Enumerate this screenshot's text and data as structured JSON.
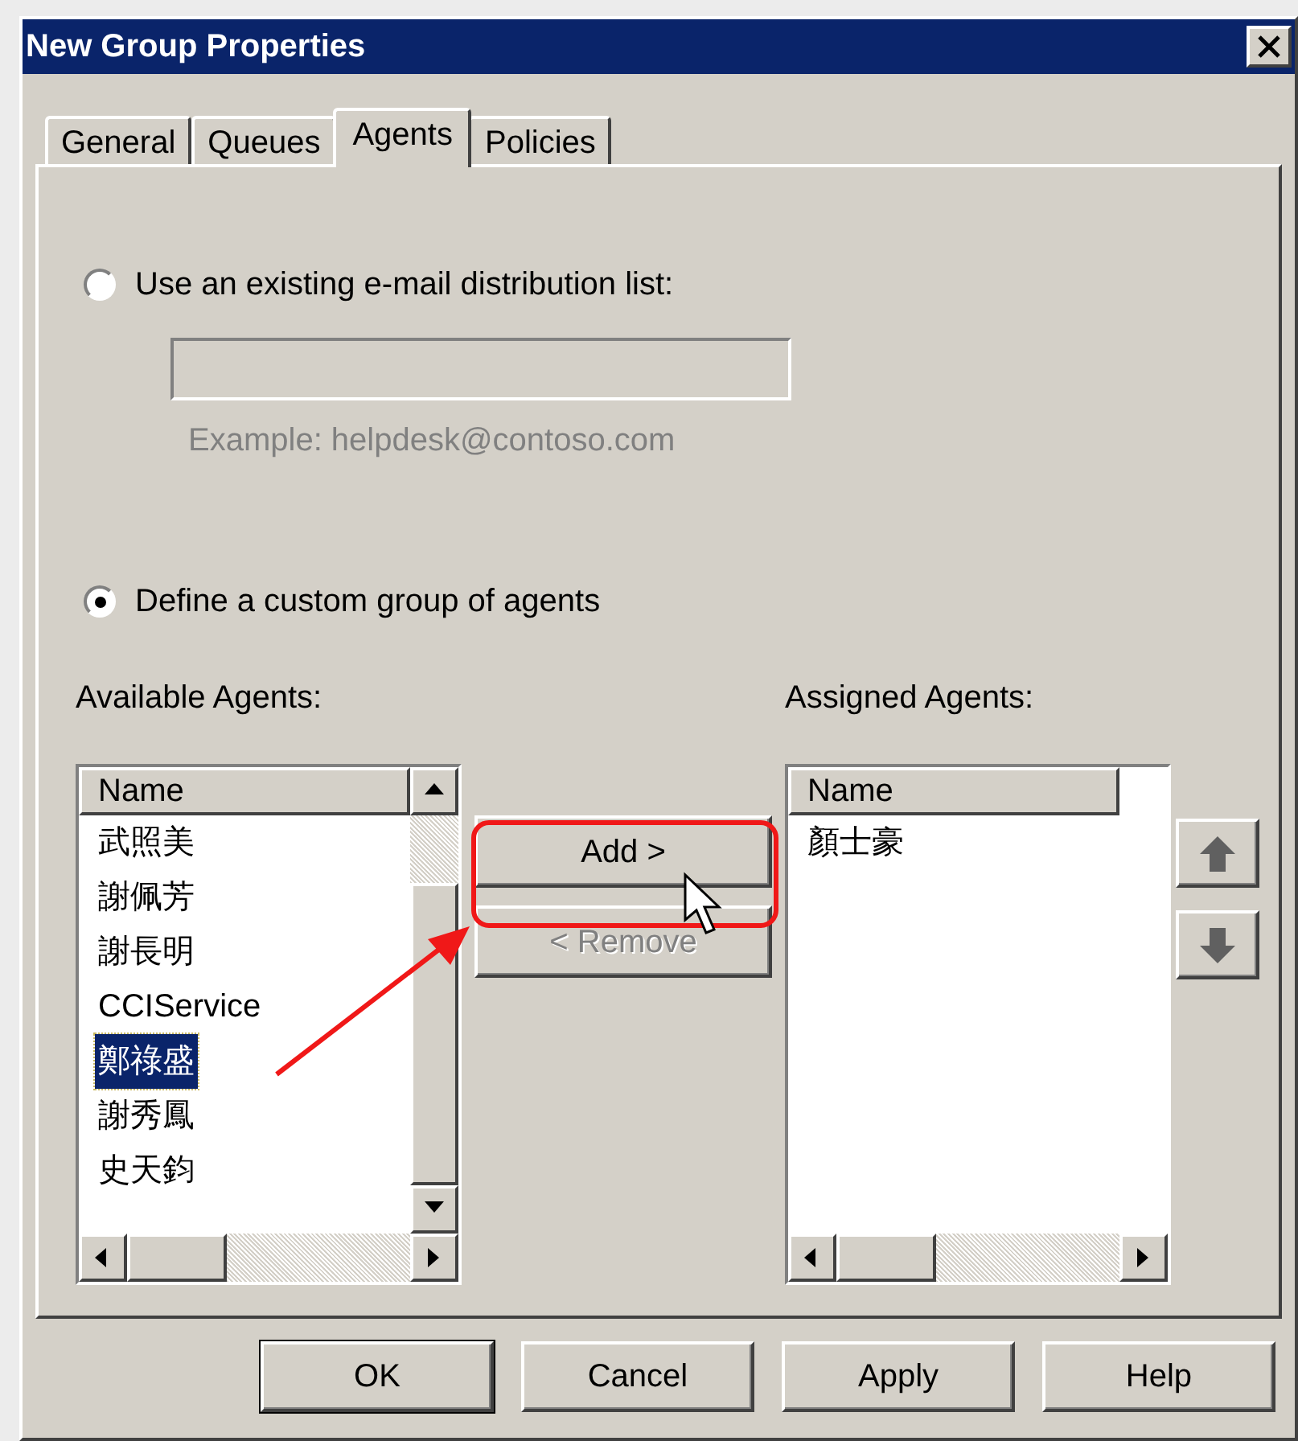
{
  "window": {
    "title": "New Group Properties"
  },
  "tabs": [
    {
      "label": "General",
      "selected": false
    },
    {
      "label": "Queues",
      "selected": false
    },
    {
      "label": "Agents",
      "selected": true
    },
    {
      "label": "Policies",
      "selected": false
    }
  ],
  "distribution_list": {
    "label": "Use an existing e-mail distribution list:",
    "selected": false,
    "disabled": true,
    "hint": "Example: helpdesk@contoso.com"
  },
  "custom_group": {
    "label": "Define a custom group of agents",
    "selected": true
  },
  "available_agents": {
    "label": "Available Agents:",
    "column": "Name",
    "items": [
      {
        "name": "武照美",
        "selected": false
      },
      {
        "name": "謝佩芳",
        "selected": false
      },
      {
        "name": "謝長明",
        "selected": false
      },
      {
        "name": "CCIService",
        "selected": false
      },
      {
        "name": "鄭祿盛",
        "selected": true
      },
      {
        "name": "謝秀鳳",
        "selected": false
      },
      {
        "name": "史天鈞",
        "selected": false
      }
    ]
  },
  "assigned_agents": {
    "label": "Assigned Agents:",
    "column": "Name",
    "items": [
      {
        "name": "顏士豪",
        "selected": false
      }
    ]
  },
  "transfer_buttons": [
    {
      "label": "Add >",
      "disabled": false
    },
    {
      "label": "< Remove",
      "disabled": true
    }
  ],
  "footer_buttons": [
    {
      "label": "OK",
      "default": true
    },
    {
      "label": "Cancel",
      "default": false
    },
    {
      "label": "Apply",
      "default": false
    },
    {
      "label": "Help",
      "default": false
    }
  ]
}
